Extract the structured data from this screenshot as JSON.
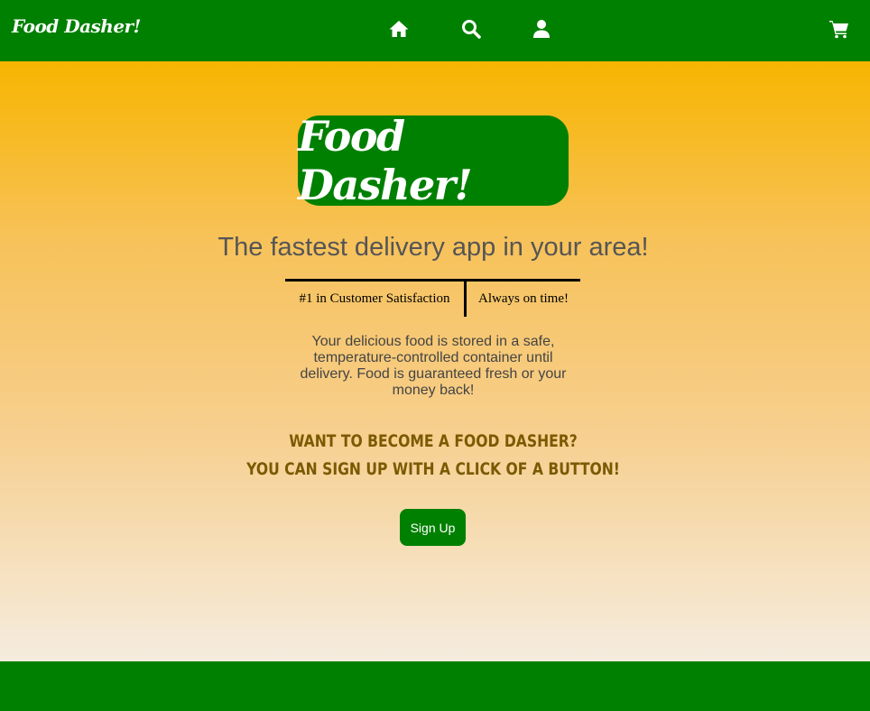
{
  "navbar": {
    "brand": "Food Dasher!",
    "icons": [
      "home-icon",
      "search-icon",
      "user-icon",
      "cart-icon"
    ]
  },
  "hero": {
    "logo": "Food Dasher!",
    "tagline": "The fastest delivery app in your area!",
    "features": [
      "#1 in Customer Satisfaction",
      "Always on time!"
    ],
    "description": "Your delicious food is stored in a safe, temperature-controlled container until delivery. Food is guaranteed fresh or your money back!",
    "cta_line1": "Want to become a Food Dasher?",
    "cta_line2": "You can sign up with a click of a button!",
    "signup_label": "Sign Up"
  },
  "colors": {
    "brand_green": "#008000",
    "gradient_top": "#f7b500",
    "gradient_bottom": "#f5ecdf",
    "cta_text": "#7a5a00"
  }
}
